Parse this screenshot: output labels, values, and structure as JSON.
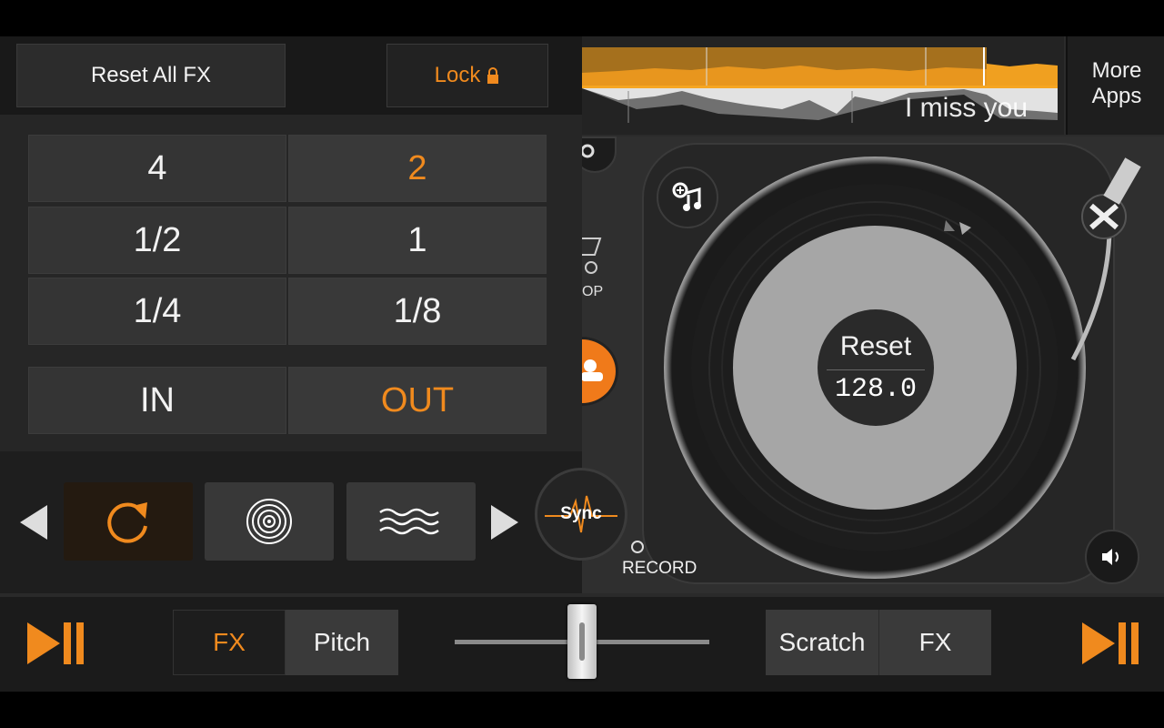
{
  "fx_panel": {
    "reset_all_label": "Reset All FX",
    "lock_label": "Lock",
    "lock_icon": "lock-icon",
    "grid": [
      [
        "4",
        "2"
      ],
      [
        "1/2",
        "1"
      ],
      [
        "1/4",
        "1/8"
      ]
    ],
    "in_label": "IN",
    "out_label": "OUT",
    "effects": [
      "loop-icon",
      "vinyl-icon",
      "wave-icon"
    ]
  },
  "waveform": {
    "track_title": "I miss you"
  },
  "more_apps": {
    "line1": "More",
    "line2": "Apps"
  },
  "turntable": {
    "reset_label": "Reset",
    "bpm": "128.0",
    "loop_partial": "OP",
    "record_label": "RECORD",
    "sync_label": "Sync"
  },
  "bottom_bar": {
    "left_fx": "FX",
    "left_pitch": "Pitch",
    "right_scratch": "Scratch",
    "right_fx": "FX",
    "crossfader_position": 0.5
  },
  "colors": {
    "accent": "#f08a1e",
    "panel": "#1f1f1f"
  }
}
